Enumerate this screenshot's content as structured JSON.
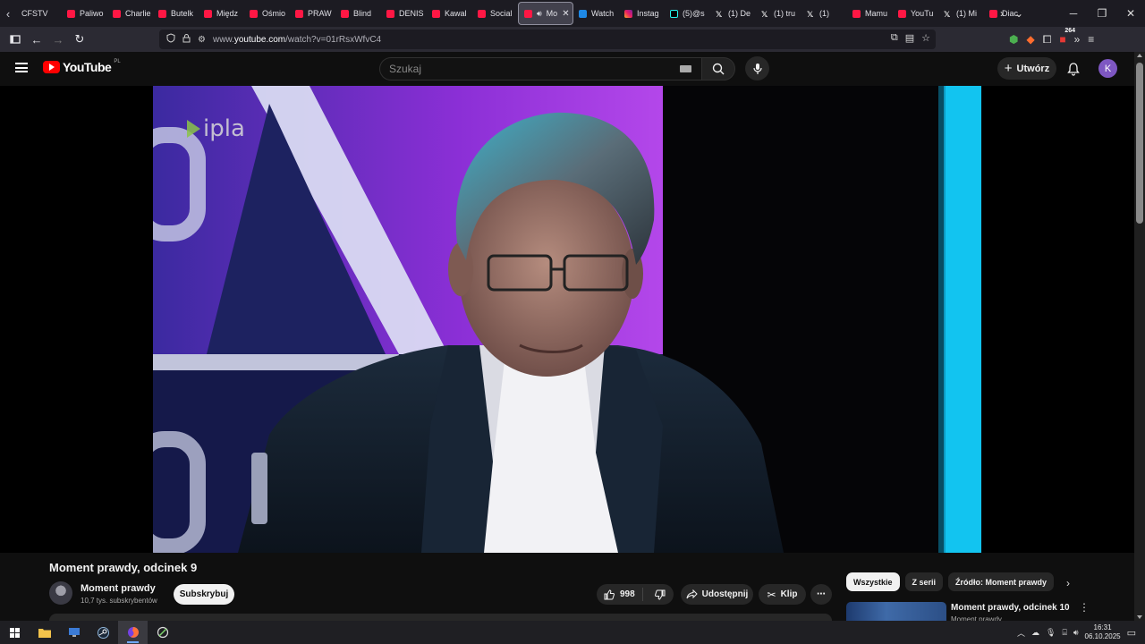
{
  "browser": {
    "tabs": [
      {
        "label": "CFSTV",
        "icon": "none"
      },
      {
        "label": "Paliwo",
        "icon": "youtube-icon"
      },
      {
        "label": "Charlie",
        "icon": "youtube-icon"
      },
      {
        "label": "Butelk",
        "icon": "youtube-icon"
      },
      {
        "label": "Międz",
        "icon": "youtube-icon"
      },
      {
        "label": "Ośmio",
        "icon": "youtube-icon"
      },
      {
        "label": "PRAW",
        "icon": "youtube-icon"
      },
      {
        "label": "Blind",
        "icon": "youtube-icon"
      },
      {
        "label": "DENIS",
        "icon": "youtube-icon"
      },
      {
        "label": "Kawal",
        "icon": "youtube-icon"
      },
      {
        "label": "Social",
        "icon": "youtube-icon"
      },
      {
        "label": "Mo",
        "icon": "youtube-icon",
        "active": true
      },
      {
        "label": "Watch",
        "icon": "watch-icon"
      },
      {
        "label": "Instag",
        "icon": "instagram-icon"
      },
      {
        "label": "(5)@s",
        "icon": "tiktok-icon"
      },
      {
        "label": "(1) De",
        "icon": "x-icon"
      },
      {
        "label": "(1) tru",
        "icon": "x-icon"
      },
      {
        "label": "(1)",
        "icon": "x-icon"
      },
      {
        "label": "Mamu",
        "icon": "youtube-icon"
      },
      {
        "label": "YouTu",
        "icon": "youtube-icon"
      },
      {
        "label": "(1) Mi",
        "icon": "x-icon"
      },
      {
        "label": "Diac",
        "icon": "youtube-icon"
      }
    ],
    "url_prefix": "www.",
    "url_domain": "youtube.com",
    "url_path": "/watch?v=01rRsxWfvC4",
    "ext_badge": "264"
  },
  "youtube": {
    "logo_text": "YouTube",
    "country_code": "PL",
    "search_placeholder": "Szukaj",
    "create_label": "Utwórz",
    "avatar_letter": "K"
  },
  "video": {
    "watermark": "ipla",
    "title": "Moment prawdy, odcinek 9",
    "channel_name": "Moment prawdy",
    "subscribers": "10,7 tys. subskrybentów",
    "subscribe_label": "Subskrybuj",
    "likes": "998",
    "share_label": "Udostępnij",
    "clip_label": "Klip"
  },
  "sidebar": {
    "chips": [
      "Wszystkie",
      "Z serii",
      "Źródło: Moment prawdy"
    ],
    "recommended": {
      "title": "Moment prawdy, odcinek 10",
      "channel": "Moment prawdy"
    }
  },
  "taskbar": {
    "time": "16:31",
    "date": "06.10.2025"
  },
  "colors": {
    "youtube_red": "#ff0000",
    "background": "#0f0f0f",
    "avatar_purple": "#7e57c2"
  }
}
